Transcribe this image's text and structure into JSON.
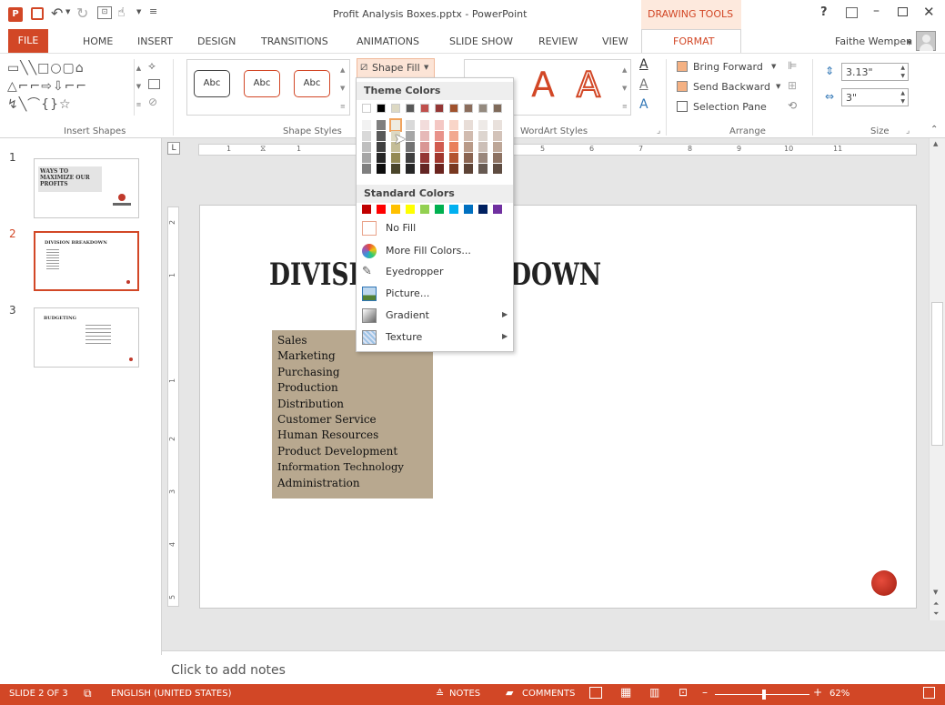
{
  "title_bar": {
    "document_title": "Profit Analysis Boxes.pptx - PowerPoint",
    "contextual_tab_group": "DRAWING TOOLS",
    "help": "?"
  },
  "ribbon_tabs": {
    "file": "FILE",
    "items": [
      "HOME",
      "INSERT",
      "DESIGN",
      "TRANSITIONS",
      "ANIMATIONS",
      "SLIDE SHOW",
      "REVIEW",
      "VIEW",
      "FORMAT"
    ],
    "active": "FORMAT",
    "user": "Faithe Wempen"
  },
  "ribbon": {
    "insert_shapes_label": "Insert Shapes",
    "shape_styles_label": "Shape Styles",
    "shape_style_sample": "Abc",
    "shape_fill_button": "Shape Fill",
    "wordart_styles_label": "WordArt Styles",
    "wordart_sample": "A",
    "arrange_label": "Arrange",
    "bring_forward": "Bring Forward",
    "send_backward": "Send Backward",
    "selection_pane": "Selection Pane",
    "size_label": "Size",
    "height_value": "3.13\"",
    "width_value": "3\""
  },
  "shape_fill_menu": {
    "theme_colors_heading": "Theme Colors",
    "theme_top_row": [
      "#ffffff",
      "#000000",
      "#ddd9c3",
      "#595959",
      "#c0504d",
      "#953735",
      "#a0522d",
      "#8b6d5c",
      "#948a7f",
      "#7f6a5a"
    ],
    "theme_columns": [
      [
        "#f2f2f2",
        "#d9d9d9",
        "#bfbfbf",
        "#a6a6a6",
        "#7f7f7f"
      ],
      [
        "#7f7f7f",
        "#595959",
        "#404040",
        "#262626",
        "#0d0d0d"
      ],
      [
        "#eeece1",
        "#ddd9c3",
        "#c4bd97",
        "#948a54",
        "#4a452a"
      ],
      [
        "#d9d9d9",
        "#a6a6a6",
        "#737373",
        "#404040",
        "#262626"
      ],
      [
        "#f2dcdb",
        "#e6b9b8",
        "#d99694",
        "#953735",
        "#632523"
      ],
      [
        "#f4c7c3",
        "#e8928a",
        "#d15b4f",
        "#a1372d",
        "#6b241e"
      ],
      [
        "#f9d5c8",
        "#f2a991",
        "#e97f5b",
        "#b35430",
        "#783820"
      ],
      [
        "#e8ddd7",
        "#d1bbaf",
        "#b99a88",
        "#8b6552",
        "#5d4336"
      ],
      [
        "#eeeae7",
        "#ddd5cf",
        "#ccbfb7",
        "#9a877c",
        "#675a52"
      ],
      [
        "#e9e1dc",
        "#d3c3b9",
        "#bda697",
        "#8d7262",
        "#5e4c41"
      ]
    ],
    "standard_colors_heading": "Standard Colors",
    "standard_colors": [
      "#c00000",
      "#ff0000",
      "#ffc000",
      "#ffff00",
      "#92d050",
      "#00b050",
      "#00b0f0",
      "#0070c0",
      "#002060",
      "#7030a0"
    ],
    "no_fill": "No Fill",
    "more_fill_colors": "More Fill Colors...",
    "eyedropper": "Eyedropper",
    "picture": "Picture...",
    "gradient": "Gradient",
    "texture": "Texture"
  },
  "slide_thumbnails": [
    {
      "number": "1",
      "title": "WAYS TO MAXIMIZE OUR PROFITS"
    },
    {
      "number": "2",
      "title": "DIVISION BREAKDOWN"
    },
    {
      "number": "3",
      "title": "BUDGETING"
    }
  ],
  "slide": {
    "title_left": "DIVISI",
    "title_right": "KDOWN",
    "box_items": [
      "Sales",
      "Marketing",
      "Purchasing",
      "Production",
      "Distribution",
      "Customer Service",
      "Human Resources",
      "Product Development",
      "Information Technology",
      "Administration"
    ]
  },
  "ruler": {
    "horizontal_left": "1",
    "horizontal_right": [
      "5",
      "6",
      "7",
      "8",
      "9",
      "10",
      "11"
    ],
    "vertical": [
      "2",
      "1",
      "1",
      "2",
      "3",
      "4",
      "5"
    ]
  },
  "notes_placeholder": "Click to add notes",
  "status_bar": {
    "slide_info": "SLIDE 2 OF 3",
    "language": "ENGLISH (UNITED STATES)",
    "notes": "NOTES",
    "comments": "COMMENTS",
    "zoom": "62%"
  },
  "colors": {
    "accent": "#d24726",
    "box_fill": "#b8a88f"
  }
}
